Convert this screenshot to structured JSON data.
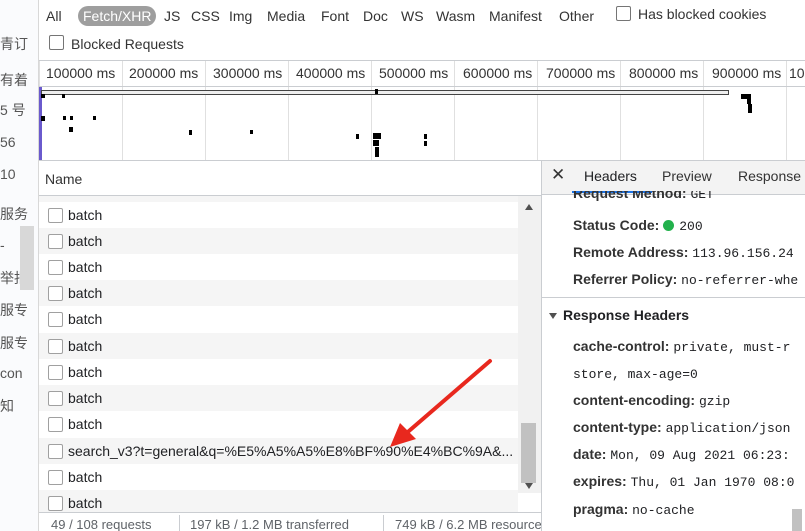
{
  "left_strip": {
    "chars": [
      "青订",
      "有着",
      "5 号",
      "56",
      "10",
      "服务",
      "-",
      "举报",
      "服专",
      "服专",
      "con",
      "知"
    ]
  },
  "filter_bar": {
    "types": [
      "All",
      "Fetch/XHR",
      "JS",
      "CSS",
      "Img",
      "Media",
      "Font",
      "Doc",
      "WS",
      "Wasm",
      "Manifest",
      "Other"
    ],
    "active_type": "Fetch/XHR",
    "has_blocked_cookies_label": "Has blocked cookies",
    "blocked_requests_label": "Blocked Requests"
  },
  "overview": {
    "tick_labels": [
      "100000 ms",
      "200000 ms",
      "300000 ms",
      "400000 ms",
      "500000 ms",
      "600000 ms",
      "700000 ms",
      "800000 ms",
      "900000 ms",
      "10"
    ]
  },
  "request_list": {
    "column_name": "Name",
    "rows": [
      "batch",
      "batch",
      "batch",
      "batch",
      "batch",
      "batch",
      "batch",
      "batch",
      "batch",
      "search_v3?t=general&q=%E5%A5%A5%E8%BF%90%E4%BC%9A&...",
      "batch",
      "batch"
    ]
  },
  "status_bar": {
    "requests": "49 / 108 requests",
    "transferred": "197 kB / 1.2 MB transferred",
    "resources": "749 kB / 6.2 MB resources"
  },
  "details": {
    "tabs": [
      "Headers",
      "Preview",
      "Response"
    ],
    "active_tab": "Headers",
    "general": [
      {
        "key": "Request Method:",
        "value": "GET"
      },
      {
        "key": "Status Code:",
        "value": "200"
      },
      {
        "key": "Remote Address:",
        "value": "113.96.156.24"
      },
      {
        "key": "Referrer Policy:",
        "value": "no-referrer-whe"
      }
    ],
    "response_headers_title": "Response Headers",
    "response_headers": [
      {
        "key": "cache-control:",
        "value": "private, must-r"
      },
      {
        "key": "",
        "value": "store, max-age=0"
      },
      {
        "key": "content-encoding:",
        "value": "gzip"
      },
      {
        "key": "content-type:",
        "value": "application/json"
      },
      {
        "key": "date:",
        "value": "Mon, 09 Aug 2021 06:23:"
      },
      {
        "key": "expires:",
        "value": "Thu, 01 Jan 1970 08:0"
      },
      {
        "key": "pragma:",
        "value": "no-cache"
      }
    ],
    "status_dot_color": "#22b14c"
  },
  "colors": {
    "accent": "#1a73e8",
    "annotation_arrow": "#e8281e"
  }
}
